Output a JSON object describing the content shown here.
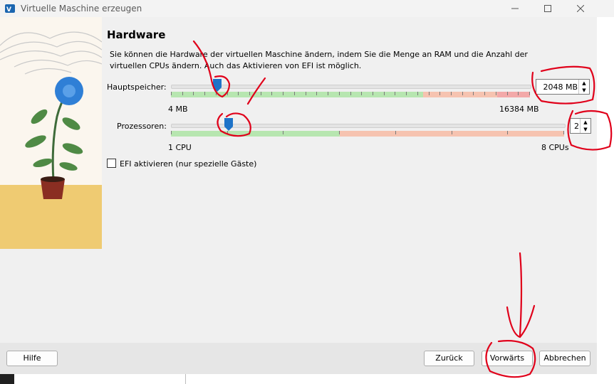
{
  "window": {
    "title": "Virtuelle Maschine erzeugen",
    "controls": [
      "minimize-icon",
      "maximize-icon",
      "close-icon"
    ]
  },
  "page": {
    "heading": "Hardware",
    "description": "Sie können die Hardware der virtuellen Maschine ändern, indem Sie die Menge an RAM und die Anzahl der virtuellen CPUs ändern. Auch das Aktivieren von EFI ist möglich."
  },
  "memory": {
    "label": "Hauptspeicher:",
    "value": "2048 MB",
    "min_label": "4 MB",
    "max_label": "16384 MB",
    "slider_fraction": 0.125
  },
  "processors": {
    "label": "Prozessoren:",
    "value": "2",
    "min_label": "1 CPU",
    "max_label": "8 CPUs",
    "slider_fraction": 0.143
  },
  "efi": {
    "label": "EFI aktivieren (nur spezielle Gäste)",
    "checked": false
  },
  "footer": {
    "help_label": "Hilfe",
    "back_label": "Zurück",
    "next_label": "Vorwärts",
    "cancel_label": "Abbrechen"
  },
  "colors": {
    "green_zone": "#b7e6b0",
    "orange_zone": "#f6c3b0",
    "red_zone": "#f3a9a9",
    "handle": "#1e73c8",
    "annotation": "#e0001a"
  }
}
